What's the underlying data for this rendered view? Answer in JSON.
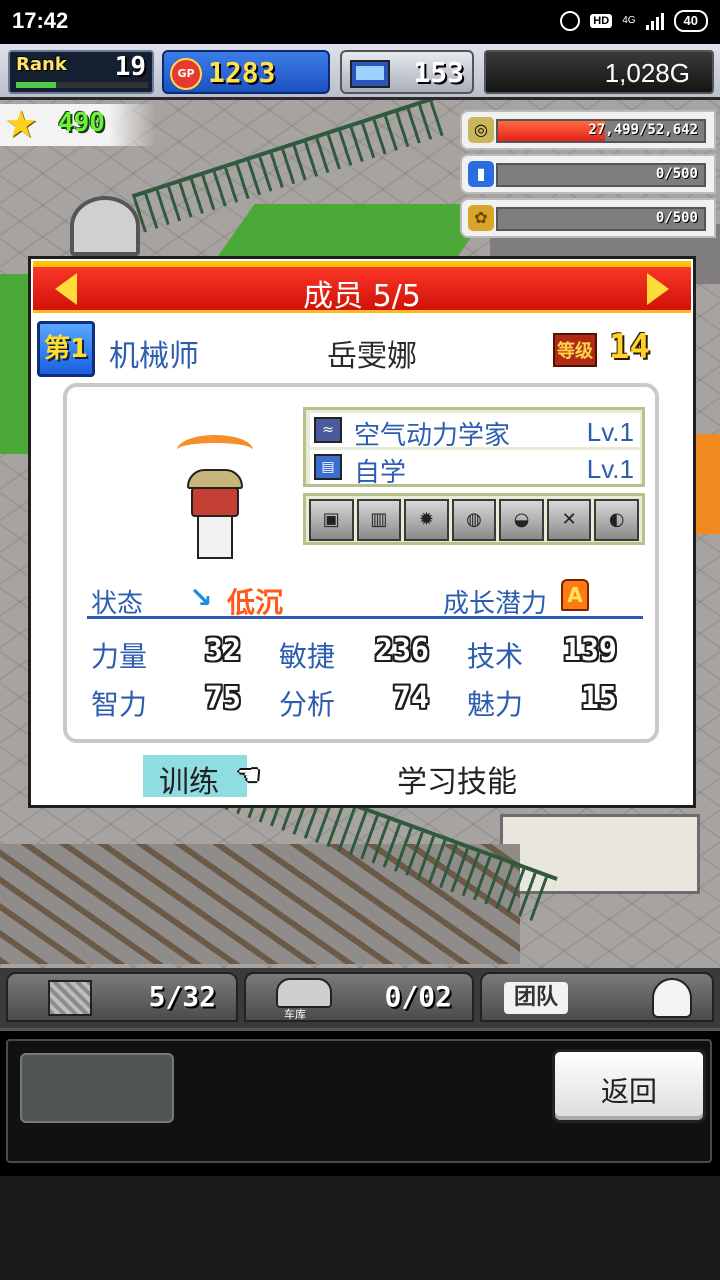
{
  "status_bar": {
    "time": "17:42",
    "hd": "HD",
    "network": "4G",
    "battery": "40"
  },
  "hud": {
    "rank_label": "Rank",
    "rank_value": "19",
    "rank_progress": 0.3,
    "gp_label": "GP",
    "gp_value": "1283",
    "pc_value": "153",
    "money": "1,028G",
    "stars": "490"
  },
  "resources": [
    {
      "icon": "coin-stack-icon",
      "text": "27,499/52,642",
      "fill": 0.52
    },
    {
      "icon": "fuel-bottle-icon",
      "text": "0/500",
      "fill": 0
    },
    {
      "icon": "wheat-icon",
      "text": "0/500",
      "fill": 0
    }
  ],
  "dialog": {
    "title": "成员 5/5",
    "rank_badge": "第1",
    "job": "机械师",
    "name": "岳雯娜",
    "level_label": "等级",
    "level_value": "14",
    "skills": [
      {
        "name": "空气动力学家",
        "level": "Lv.1"
      },
      {
        "name": "自学",
        "level": "Lv.1"
      }
    ],
    "status_label": "状态",
    "mood": "低沉",
    "growth_label": "成长潜力",
    "growth_grade": "A",
    "stats": [
      {
        "label": "力量",
        "value": "32"
      },
      {
        "label": "敏捷",
        "value": "236"
      },
      {
        "label": "技术",
        "value": "139"
      },
      {
        "label": "智力",
        "value": "75"
      },
      {
        "label": "分析",
        "value": "74"
      },
      {
        "label": "魅力",
        "value": "15"
      }
    ],
    "train_label": "训练",
    "learn_label": "学习技能"
  },
  "bottom_tabs": {
    "parts_count": "5/32",
    "garage_label": "车库",
    "garage_count": "0/02",
    "team_label": "团队"
  },
  "back_label": "返回",
  "colors": {
    "accent_blue": "#2c5db0",
    "header_red": "#e8211a",
    "mood_orange": "#ff5a1a",
    "train_tab": "#8fdde0"
  }
}
